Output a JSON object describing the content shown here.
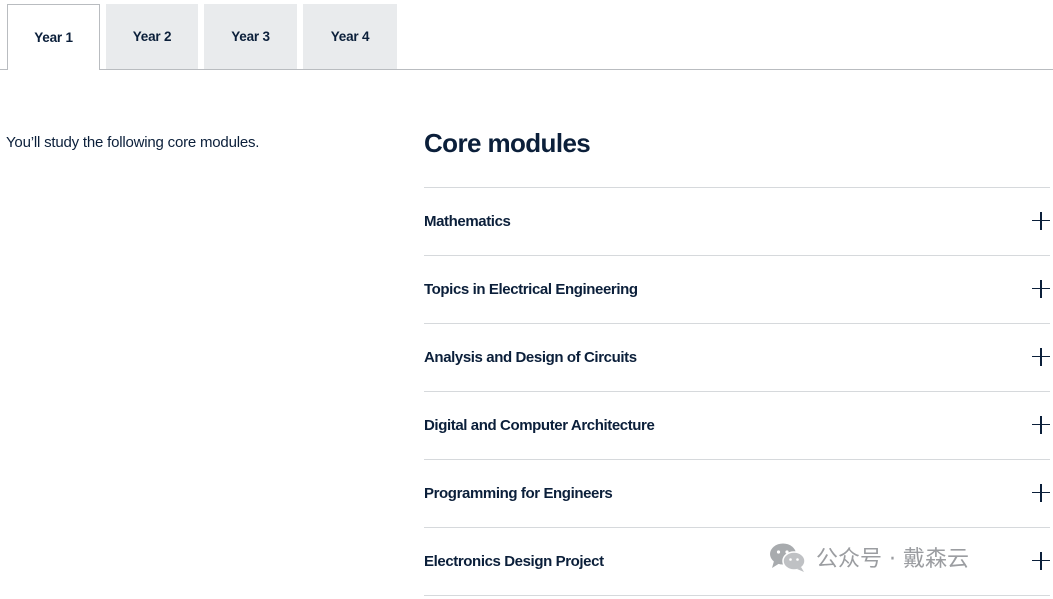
{
  "tabs": [
    {
      "label": "Year 1",
      "active": true
    },
    {
      "label": "Year 2",
      "active": false
    },
    {
      "label": "Year 3",
      "active": false
    },
    {
      "label": "Year 4",
      "active": false
    }
  ],
  "intro": {
    "text": "You’ll study the following core modules."
  },
  "core_modules": {
    "title": "Core modules",
    "items": [
      {
        "label": "Mathematics",
        "icon": "plus-icon"
      },
      {
        "label": "Topics in Electrical Engineering",
        "icon": "plus-icon"
      },
      {
        "label": "Analysis and Design of Circuits",
        "icon": "plus-icon"
      },
      {
        "label": "Digital and Computer Architecture",
        "icon": "plus-icon"
      },
      {
        "label": "Programming for Engineers",
        "icon": "plus-icon"
      },
      {
        "label": "Electronics Design Project",
        "icon": "plus-icon"
      }
    ]
  },
  "watermark": {
    "text": "公众号 · 戴森云",
    "icon": "wechat-icon"
  },
  "colors": {
    "text": "#0b1f3a",
    "tab_inactive_bg": "#e9ebed",
    "divider": "#d6d9dc"
  }
}
